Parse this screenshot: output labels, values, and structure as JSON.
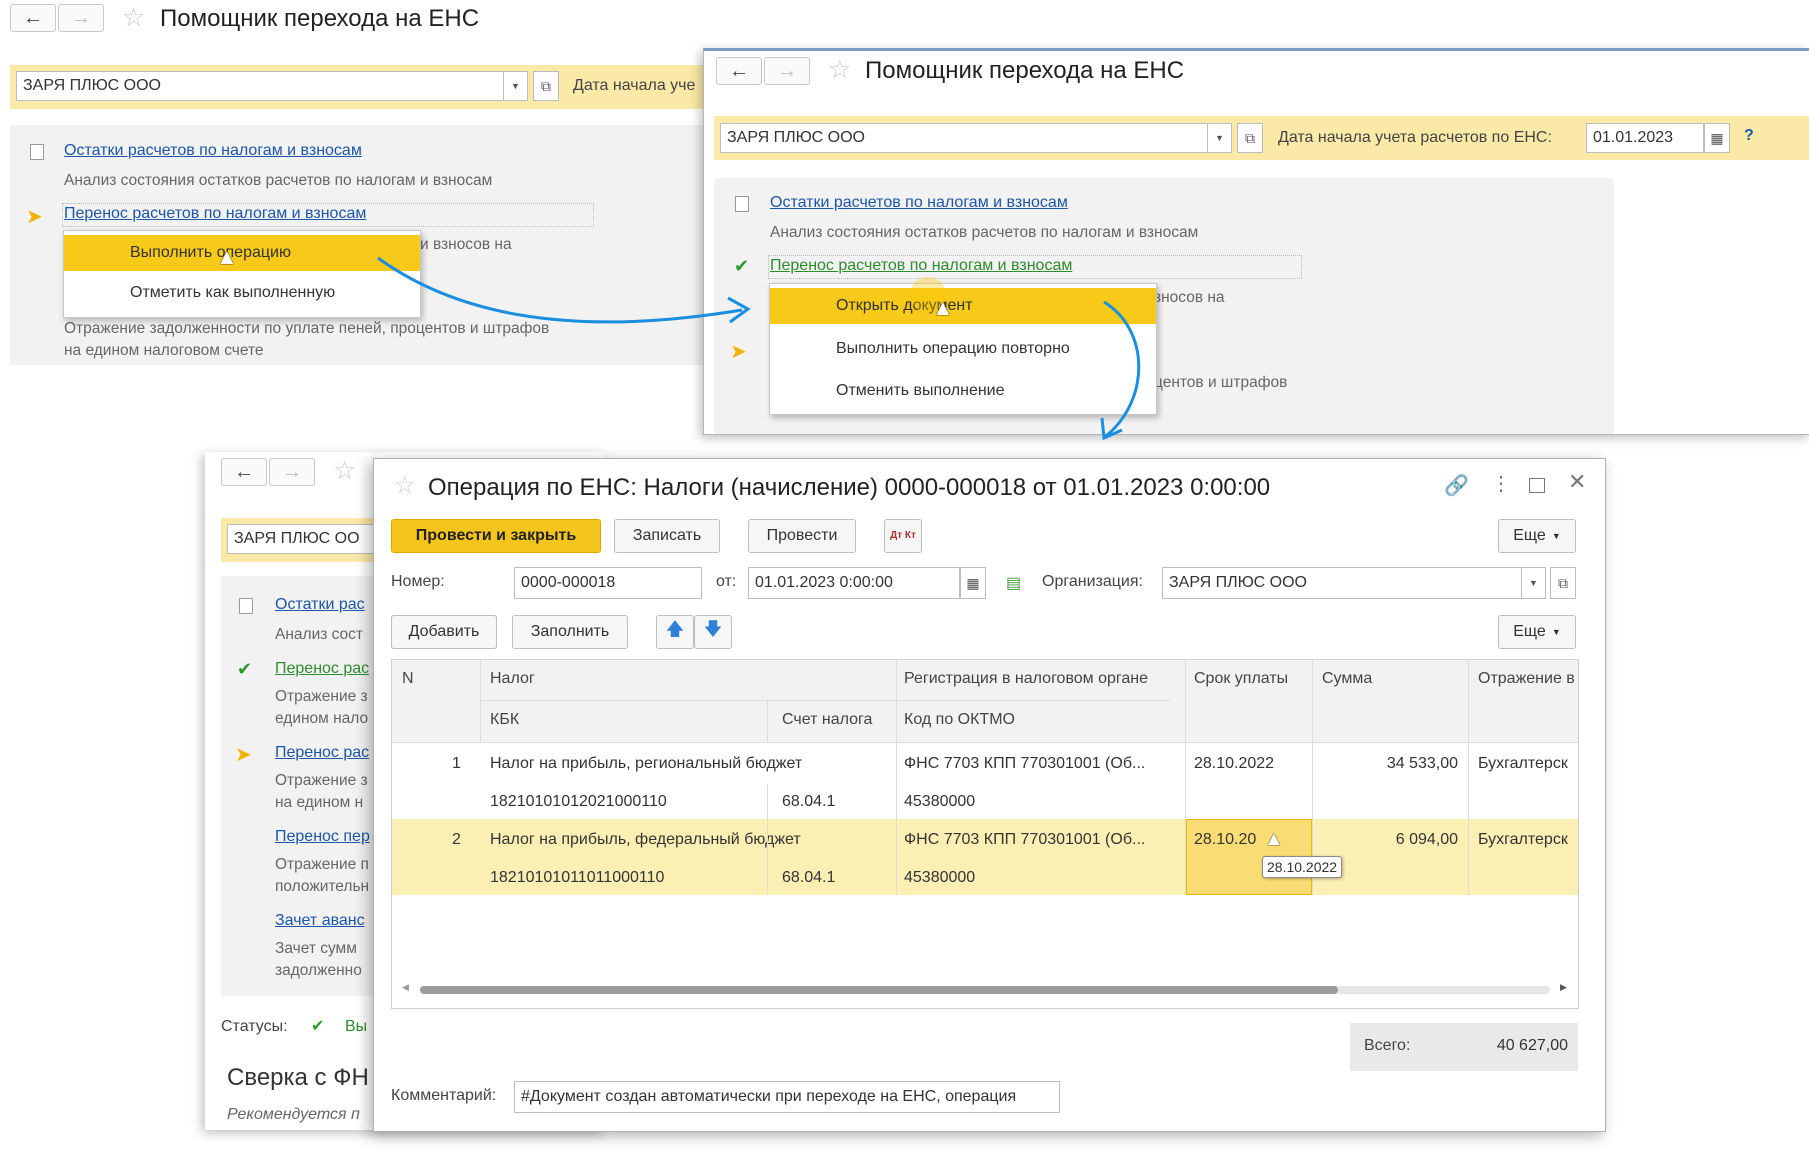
{
  "window1": {
    "title": "Помощник перехода на ЕНС",
    "org": "ЗАРЯ ПЛЮС ООО",
    "date_label": "Дата начала уче",
    "steps": [
      {
        "link": "Остатки расчетов по налогам и взносам",
        "desc": "Анализ состояния остатков расчетов по налогам и взносам"
      },
      {
        "link": "Перенос расчетов по налогам и взносам",
        "desc": "и взносов на",
        "desc2": "Отражение задолженности по уплате пеней, процентов и штрафов",
        "desc3": "на едином налоговом счете"
      }
    ],
    "menu": [
      "Выполнить операцию",
      "Отметить как выполненную"
    ]
  },
  "window2": {
    "title": "Помощник перехода на ЕНС",
    "org": "ЗАРЯ ПЛЮС ООО",
    "date_label": "Дата начала учета расчетов по ЕНС:",
    "date_value": "01.01.2023",
    "help": "?",
    "steps": [
      {
        "link": "Остатки расчетов по налогам и взносам",
        "desc": "Анализ состояния остатков расчетов по налогам и взносам"
      },
      {
        "link": "Перенос расчетов по налогам и взносам",
        "desc": "зносов на",
        "desc2": "центов и штрафов"
      }
    ],
    "menu": [
      "Открыть документ",
      "Выполнить операцию повторно",
      "Отменить выполнение"
    ]
  },
  "window3": {
    "org": "ЗАРЯ ПЛЮС ОО",
    "steps": [
      {
        "link": "Остатки рас",
        "desc": "Анализ сост"
      },
      {
        "link": "Перенос рас",
        "desc": "Отражение з",
        "desc2": "едином нало"
      },
      {
        "link": "Перенос рас",
        "desc": "Отражение з",
        "desc2": "на едином н"
      },
      {
        "link": "Перенос пер",
        "desc": "Отражение п",
        "desc2": "положительн"
      },
      {
        "link": "Зачет аванс",
        "desc": "Зачет сумм",
        "desc2": "задолженно"
      }
    ],
    "status_label": "Статусы:",
    "status_value": "Вы",
    "section_title": "Сверка с ФН",
    "section_sub": "Рекомендуется п"
  },
  "doc": {
    "title": "Операция по ЕНС: Налоги (начисление) 0000-000018 от 01.01.2023 0:00:00",
    "toolbar": {
      "post_close": "Провести и закрыть",
      "save": "Записать",
      "post": "Провести",
      "dtkt": "Дт Кт",
      "more": "Еще"
    },
    "number_label": "Номер:",
    "number_value": "0000-000018",
    "from_label": "от:",
    "date_value": "01.01.2023  0:00:00",
    "org_label": "Организация:",
    "org_value": "ЗАРЯ ПЛЮС ООО",
    "table_toolbar": {
      "add": "Добавить",
      "fill": "Заполнить",
      "more": "Еще"
    },
    "columns": {
      "n": "N",
      "tax": "Налог",
      "kbk": "КБК",
      "account": "Счет налога",
      "registration": "Регистрация в налоговом органе",
      "oktmo": "Код по ОКТМО",
      "due": "Срок уплаты",
      "sum": "Сумма",
      "reflection": "Отражение в"
    },
    "rows": [
      {
        "n": "1",
        "tax": "Налог на прибыль, региональный бюджет",
        "kbk": "18210101012021000110",
        "account": "68.04.1",
        "registration": "ФНС 7703 КПП 770301001 (Об...",
        "oktmo": "45380000",
        "due": "28.10.2022",
        "sum": "34 533,00",
        "reflection": "Бухгалтерск"
      },
      {
        "n": "2",
        "tax": "Налог на прибыль, федеральный бюджет",
        "kbk": "18210101011011000110",
        "account": "68.04.1",
        "registration": "ФНС 7703 КПП 770301001 (Об...",
        "oktmo": "45380000",
        "due": "28.10.20",
        "sum": "6 094,00",
        "reflection": "Бухгалтерск"
      }
    ],
    "tooltip": "28.10.2022",
    "total_label": "Всего:",
    "total_value": "40 627,00",
    "comment_label": "Комментарий:",
    "comment_value": "#Документ создан автоматически при переходе на ЕНС, операция"
  },
  "colors": {
    "accent_yellow": "#f7c918",
    "link_blue": "#1d55a8",
    "arrow_blue": "#1a8fe0",
    "row_selected": "#fcefb4"
  }
}
